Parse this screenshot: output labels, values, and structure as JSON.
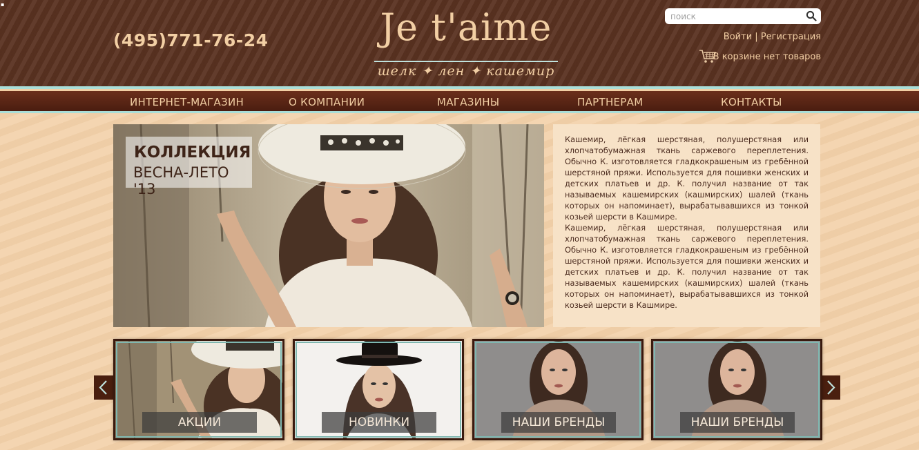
{
  "header": {
    "phone": "(495)771-76-24",
    "logo_title": "Je t'aime",
    "logo_tagline": "шелк ✦ лен ✦ кашемир",
    "search_placeholder": "поиск",
    "login": "Войти",
    "separator": "|",
    "register": "Регистрация",
    "cart_text": "В корзине нет товаров"
  },
  "nav": {
    "items": [
      {
        "label": "ИНТЕРНЕТ-МАГАЗИН"
      },
      {
        "label": "О КОМПАНИИ"
      },
      {
        "label": "МАГАЗИНЫ"
      },
      {
        "label": "ПАРТНЕРАМ"
      },
      {
        "label": "КОНТАКТЫ"
      }
    ]
  },
  "hero": {
    "caption_line1": "КОЛЛЕКЦИЯ",
    "caption_line2": "ВЕСНА-ЛЕТО '13"
  },
  "about": {
    "paragraph1": "Кашемир, лёгкая шерстяная, полушерстяная или хлопчатобумажная ткань саржевого переплетения. Обычно К. изготовляется гладкокрашеным из гребённой шерстяной пряжи. Используется для пошивки женских и детских платьев и др. К. получил название от так называемых кашемирских (кашмирских) шалей (ткань которых он напоминает), вырабатывавшихся из тонкой козьей шерсти в Кашмире.",
    "paragraph2": "Кашемир, лёгкая шерстяная, полушерстяная или хлопчатобумажная ткань саржевого переплетения. Обычно К. изготовляется гладкокрашеным из гребённой шерстяной пряжи. Используется для пошивки женских и детских платьев и др. К. получил название от так называемых кашемирских (кашмирских) шалей (ткань которых он напоминает), вырабатывавшихся из тонкой козьей шерсти в Кашмире."
  },
  "tiles": [
    {
      "label": "АКЦИИ"
    },
    {
      "label": "НОВИНКИ"
    },
    {
      "label": "НАШИ БРЕНДЫ"
    },
    {
      "label": "НАШИ БРЕНДЫ"
    }
  ],
  "icons": {
    "search": "search-icon",
    "cart": "cart-icon",
    "prev": "chevron-left-icon",
    "next": "chevron-right-icon"
  },
  "colors": {
    "header_bg": "#5a3221",
    "accent_text": "#f2cfa4",
    "accent_teal": "#a9ded8",
    "nav_bg": "#5a2414",
    "page_bg": "#f3d3ad"
  }
}
